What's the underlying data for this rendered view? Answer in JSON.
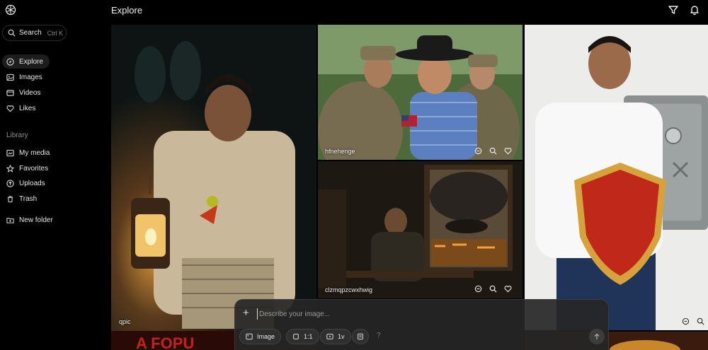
{
  "header": {
    "title": "Explore"
  },
  "sidebar": {
    "search": {
      "label": "Search",
      "shortcut": "Ctrl K"
    },
    "nav": [
      {
        "label": "Explore",
        "icon": "compass-icon",
        "active": true
      },
      {
        "label": "Images",
        "icon": "image-icon"
      },
      {
        "label": "Videos",
        "icon": "video-icon"
      },
      {
        "label": "Likes",
        "icon": "heart-icon"
      }
    ],
    "library_label": "Library",
    "library": [
      {
        "label": "My media",
        "icon": "media-icon"
      },
      {
        "label": "Favorites",
        "icon": "star-icon"
      },
      {
        "label": "Uploads",
        "icon": "upload-icon"
      },
      {
        "label": "Trash",
        "icon": "trash-icon"
      }
    ],
    "new_folder": {
      "label": "New folder",
      "icon": "new-folder-icon"
    }
  },
  "tiles": [
    {
      "label": "qpic",
      "scene": "Man holding a lantern at night with ghostly figures behind"
    },
    {
      "label": "hfnehenge",
      "scene": "Cowboy hugging soldiers"
    },
    {
      "label": "clzmqpzcwxhwig",
      "scene": "Man at table by window with storm and ship"
    },
    {
      "label": "",
      "scene": "Man holding red shield beside a safe"
    }
  ],
  "prompt": {
    "placeholder": "Describe your image...",
    "image_label": "Image",
    "ratio_label": "1:1",
    "version_label": "1v",
    "help_label": "?"
  },
  "colors": {
    "background": "#000000",
    "prompt_bg": "#262626",
    "accent": "#f2f2f2"
  }
}
